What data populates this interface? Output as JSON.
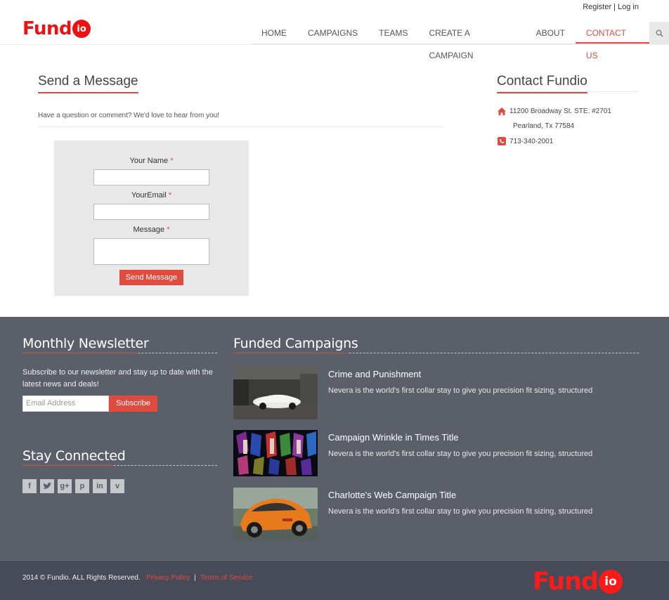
{
  "header": {
    "register": "Register",
    "login": "Log in",
    "logo_word": "Fund",
    "logo_badge": "io",
    "nav": [
      "HOME",
      "CAMPAIGNS",
      "TEAMS",
      "CREATE A CAMPAIGN",
      "ABOUT",
      "CONTACT US"
    ],
    "active_nav": "CONTACT US"
  },
  "message": {
    "title": "Send a Message",
    "intro": "Have a question or comment? We'd love to hear from you!",
    "name_label": "Your Name",
    "email_label": "YourEmail",
    "message_label": "Message",
    "required_mark": "*",
    "submit": "Send Message"
  },
  "contact": {
    "title": "Contact Fundio",
    "address1": "11200 Broadway St. STE: #2701",
    "address2": "Pearland, Tx 77584",
    "phone": "713-340-2001"
  },
  "newsletter": {
    "title": "Monthly Newsletter",
    "text": "Subscribe to our newsletter and stay up to date with the latest news and deals!",
    "placeholder": "Email Address",
    "button": "Subscribe"
  },
  "social": {
    "title": "Stay Connected",
    "icons": [
      "facebook-icon",
      "twitter-icon",
      "google-plus-icon",
      "pinterest-icon",
      "linkedin-icon",
      "vimeo-icon"
    ]
  },
  "funded": {
    "title": "Funded Campaigns",
    "items": [
      {
        "title": "Crime and Punishment",
        "desc": "Nevera is the world's first collar stay to give you precision fit sizing, structured"
      },
      {
        "title": "Campaign Wrinkle in Times Title",
        "desc": "Nevera is the world's first collar stay to give you precision fit sizing, structured"
      },
      {
        "title": "Charlotte's Web Campaign Title",
        "desc": "Nevera is the world's first collar stay to give you precision fit sizing, structured"
      }
    ]
  },
  "footer": {
    "copyright": "2014 © Fundio. ALL Rights Reserved.",
    "privacy": "Privacy Policy",
    "separator": "|",
    "terms": "Terms of Service"
  },
  "colors": {
    "accent": "#e04b3f",
    "footer_bg": "#5a5f6a",
    "bottom_bg": "#464b57"
  }
}
